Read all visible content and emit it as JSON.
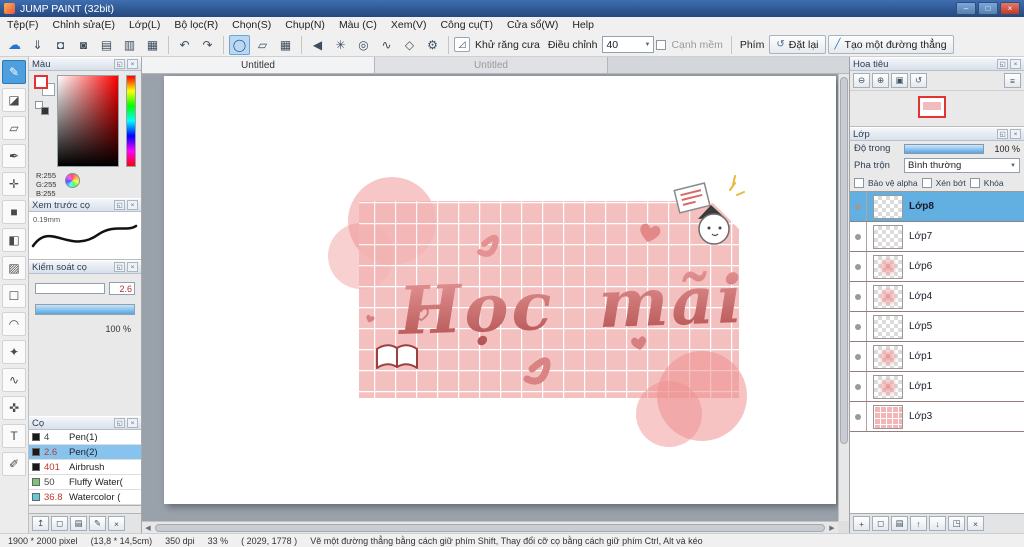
{
  "window": {
    "title": "JUMP PAINT (32bit)",
    "controls": {
      "minimize": "–",
      "maximize": "□",
      "close": "×"
    }
  },
  "menu": {
    "items": [
      "Tệp(F)",
      "Chỉnh sửa(E)",
      "Lớp(L)",
      "Bộ lọc(R)",
      "Chọn(S)",
      "Chụp(N)",
      "Màu (C)",
      "Xem(V)",
      "Công cụ(T)",
      "Cửa sổ(W)",
      "Help"
    ]
  },
  "icons": {
    "popout": "◱",
    "close": "×",
    "arrow_down": "▼",
    "zoom_out": "⊖",
    "zoom_in": "⊕",
    "zoom_fit": "▣",
    "rotate": "↺",
    "menu": "≡",
    "brush_tools": [
      "↥",
      "◻",
      "▤",
      "✎",
      "×"
    ],
    "layer_tools": [
      "+",
      "◻",
      "▤",
      "↑",
      "↓",
      "◳",
      "×"
    ]
  },
  "toolbar": {
    "icons": {
      "cloud": "☁",
      "save": "⇓",
      "comment": "◘",
      "gallery": "◙",
      "panel_a": "▤",
      "panel_b": "▥",
      "table": "▦",
      "undo": "↶",
      "redo": "↷",
      "ellipse": "◯",
      "polygon": "▱",
      "grid": "▦",
      "snap_off": "◀",
      "snap_parallel": "✳",
      "snap_radial": "◎",
      "snap_curve": "∿",
      "snap_vanish": "◇",
      "snap_settings": "⚙",
      "antialias": "◿",
      "reset": "↺",
      "line": "╱"
    },
    "antialias_label": "Khử răng cưa",
    "adjust_label": "Điều chỉnh",
    "adjust_value": "40",
    "soft_edge_label": "Cạnh mềm",
    "key_label": "Phím",
    "reset_label": "Đặt lại",
    "line_label": "Tạo một đường thẳng"
  },
  "tools": {
    "items": [
      {
        "name": "brush",
        "glyph": "✎"
      },
      {
        "name": "eraser",
        "glyph": "◪"
      },
      {
        "name": "stamp",
        "glyph": "▱"
      },
      {
        "name": "pen",
        "glyph": "✒"
      },
      {
        "name": "move",
        "glyph": "✛"
      },
      {
        "name": "shape",
        "glyph": "■"
      },
      {
        "name": "bucket",
        "glyph": "◧"
      },
      {
        "name": "gradient",
        "glyph": "▨"
      },
      {
        "name": "select",
        "glyph": "☐"
      },
      {
        "name": "lasso",
        "glyph": "◠"
      },
      {
        "name": "wand",
        "glyph": "✦"
      },
      {
        "name": "curve",
        "glyph": "∿"
      },
      {
        "name": "operation",
        "glyph": "✜"
      },
      {
        "name": "text",
        "glyph": "T"
      },
      {
        "name": "eyedropper",
        "glyph": "✐"
      }
    ]
  },
  "tabs": {
    "items": [
      {
        "label": "Untitled"
      },
      {
        "label": "Untitled"
      }
    ]
  },
  "panels": {
    "color": {
      "title": "Màu",
      "r": "R:255",
      "g": "G:255",
      "b": "B:255"
    },
    "preview": {
      "title": "Xem trước cọ",
      "size_label": "0.19mm"
    },
    "control": {
      "title": "Kiểm soát cọ",
      "size_value": "2.6",
      "opacity_value": "100 %"
    },
    "brushes": {
      "title": "Cọ",
      "items": [
        {
          "size": "4",
          "name": "Pen(1)",
          "swatch": "#1a1a1a"
        },
        {
          "size": "2.6",
          "name": "Pen(2)",
          "swatch": "#1a1a1a",
          "selected": true
        },
        {
          "size": "401",
          "name": "Airbrush",
          "swatch": "#1a1a1a"
        },
        {
          "size": "50",
          "name": "Fluffy Water(",
          "swatch": "#7cc576"
        },
        {
          "size": "36.8",
          "name": "Watercolor (",
          "swatch": "#63c8d8"
        }
      ]
    },
    "navigator": {
      "title": "Hoa tiêu"
    },
    "layers": {
      "title": "Lớp",
      "opacity_label": "Độ trong",
      "opacity_value": "100 %",
      "blend_label": "Pha trộn",
      "blend_value": "Bình thường",
      "check_alpha": "Bảo vệ alpha",
      "check_clip": "Xén bớt",
      "check_lock": "Khóa",
      "items": [
        {
          "name": "Lớp8",
          "selected": true,
          "thumb": "light"
        },
        {
          "name": "Lớp7",
          "thumb": "light"
        },
        {
          "name": "Lớp6",
          "thumb": "pink"
        },
        {
          "name": "Lớp4",
          "thumb": "pink"
        },
        {
          "name": "Lớp5",
          "thumb": "light"
        },
        {
          "name": "Lớp1",
          "thumb": "pink"
        },
        {
          "name": "Lớp1",
          "thumb": "pink"
        },
        {
          "name": "Lớp3",
          "thumb": "full"
        }
      ]
    }
  },
  "artwork": {
    "title_text": "Học mãi",
    "accent_pink": "#f2b4b4",
    "accent_red": "#b24f4f"
  },
  "statusbar": {
    "size": "1900 * 2000 pixel",
    "dimensions": "(13,8 * 14,5cm)",
    "dpi": "350 dpi",
    "zoom": "33 %",
    "coords": "( 2029, 1778 )",
    "hint": "Vẽ một đường thẳng bằng cách giữ phím Shift, Thay đổi cỡ cọ bằng cách giữ phím Ctrl, Alt và kéo"
  }
}
